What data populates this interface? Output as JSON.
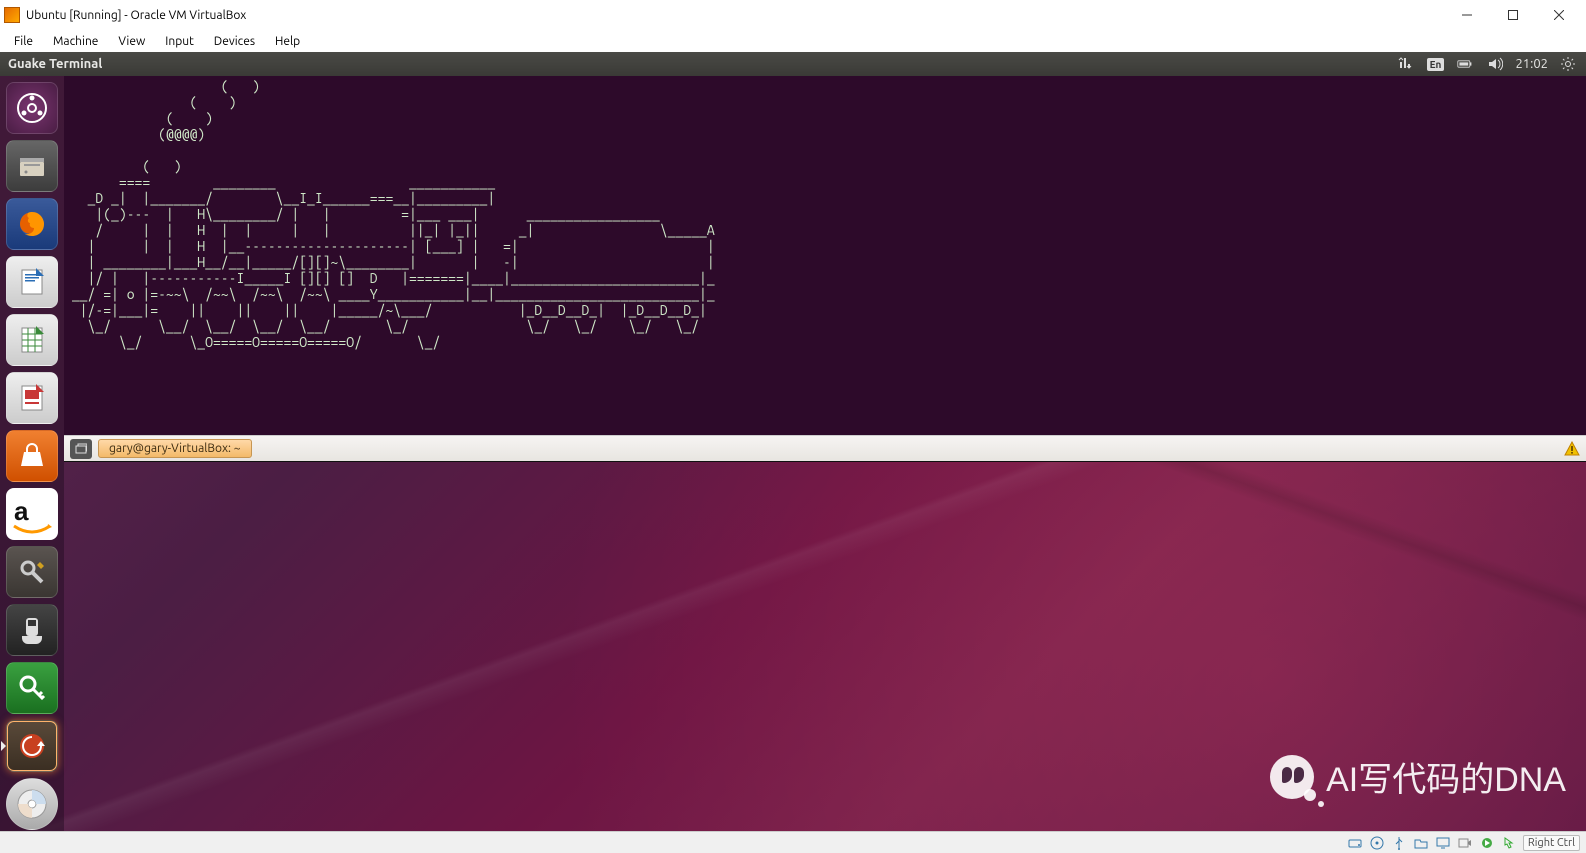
{
  "host": {
    "title": "Ubuntu [Running] - Oracle VM VirtualBox",
    "menu": {
      "file": "File",
      "machine": "Machine",
      "view": "View",
      "input": "Input",
      "devices": "Devices",
      "help": "Help"
    },
    "hostkey": "Right Ctrl"
  },
  "ubuntu_panel": {
    "app_title": "Guake Terminal",
    "lang_indicator": "En",
    "clock": "21:02"
  },
  "launcher": {
    "items": [
      {
        "name": "dash",
        "label": "Dash"
      },
      {
        "name": "files",
        "label": "Files"
      },
      {
        "name": "firefox",
        "label": "Firefox"
      },
      {
        "name": "writer",
        "label": "LibreOffice Writer"
      },
      {
        "name": "calc",
        "label": "LibreOffice Calc"
      },
      {
        "name": "impress",
        "label": "LibreOffice Impress"
      },
      {
        "name": "software",
        "label": "Ubuntu Software"
      },
      {
        "name": "amazon",
        "label": "Amazon"
      },
      {
        "name": "settings",
        "label": "System Settings"
      },
      {
        "name": "gaming",
        "label": "Game/Controller"
      },
      {
        "name": "passwords",
        "label": "Passwords"
      },
      {
        "name": "updater",
        "label": "Software Updater"
      },
      {
        "name": "disc",
        "label": "Disc"
      }
    ]
  },
  "guake": {
    "tab_label": "gary@gary-VirtualBox: ~",
    "ascii_art": "                    (   )\n                (    )\n             (    )\n            (@@@@)\n\n          (   )\n       ====        ________                 ___________\n   _D _|  |_______/        \\__I_I______===__|_________|\n    |(_)---  |   H\\________/ |   |         =|___ ___|      _________________\n    /     |  |   H  |  |     |   |          ||_| |_||     _|                \\_____A\n   |      |  |   H  |__---------------------| [___] |   =|                        |\n   | ________|___H__/__|_____/[][]~\\________|       |   -|                        |\n   |/ |   |-----------I_____I [][] []  D   |=======|____|________________________|_\n __/ =| o |=-~~\\  /~~\\  /~~\\  /~~\\ ____Y___________|__|__________________________|_\n  |/-=|___|=    ||    ||    ||    |_____/~\\___/           |_D__D__D_|  |_D__D__D_|\n   \\_/      \\__/  \\__/  \\__/  \\__/       \\_/               \\_/   \\_/    \\_/   \\_/\n       \\_/      \\_O=====O=====O=====O/       \\_/"
  },
  "watermark": {
    "text": "AI写代码的DNA"
  }
}
